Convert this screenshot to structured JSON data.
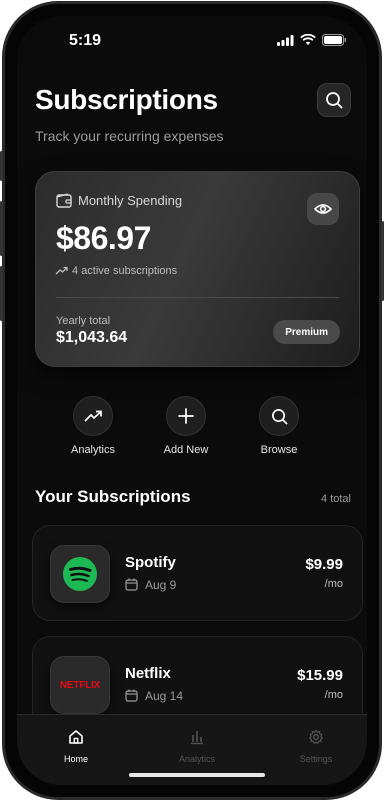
{
  "status": {
    "time": "5:19"
  },
  "header": {
    "title": "Subscriptions",
    "subtitle": "Track your recurring expenses",
    "search_icon": "search-icon"
  },
  "spending_card": {
    "label": "Monthly Spending",
    "amount": "$86.97",
    "active_text": "4 active subscriptions",
    "yearly_label": "Yearly total",
    "yearly_value": "$1,043.64",
    "badge": "Premium"
  },
  "actions": [
    {
      "label": "Analytics",
      "icon": "trending-up-icon"
    },
    {
      "label": "Add New",
      "icon": "plus-icon"
    },
    {
      "label": "Browse",
      "icon": "search-icon"
    }
  ],
  "subscriptions_section": {
    "title": "Your Subscriptions",
    "count": "4 total",
    "items": [
      {
        "name": "Spotify",
        "date": "Aug 9",
        "price": "$9.99",
        "period": "/mo",
        "logo": "spotify-logo",
        "brand_color": "#1DB954"
      },
      {
        "name": "Netflix",
        "date": "Aug 14",
        "price": "$15.99",
        "period": "/mo",
        "logo": "netflix-logo",
        "logo_text": "NETFLIX",
        "brand_color": "#E50914"
      }
    ]
  },
  "tabbar": {
    "items": [
      {
        "label": "Home",
        "icon": "home-icon",
        "active": true
      },
      {
        "label": "Analytics",
        "icon": "bar-chart-icon",
        "active": false
      },
      {
        "label": "Settings",
        "icon": "gear-icon",
        "active": false
      }
    ]
  },
  "colors": {
    "background": "#0b0b0b",
    "card": "#2c2c2c",
    "muted_text": "#9b9b9b"
  }
}
